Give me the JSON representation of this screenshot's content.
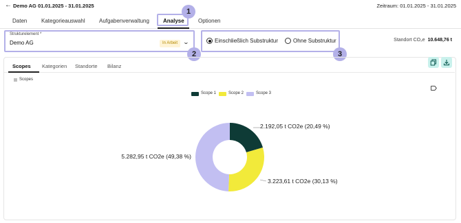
{
  "header": {
    "title": "Demo AG 01.01.2025 - 31.01.2025",
    "period_label": "Zeitraum:",
    "period_value": "01.01.2025 - 31.01.2025"
  },
  "tabs": [
    "Daten",
    "Kategorieauswahl",
    "Aufgabenverwaltung",
    "Analyse",
    "Optionen"
  ],
  "active_tab": "Analyse",
  "callouts": [
    "1",
    "2",
    "3"
  ],
  "structure": {
    "label": "Strukturelement *",
    "value": "Demo AG",
    "status": "In Arbeit"
  },
  "options": {
    "include_label": "Einschließlich Substruktur",
    "exclude_label": "Ohne Substruktur",
    "selected": "include"
  },
  "standort": {
    "label": "Standort CO₂e",
    "value": "10.648,76 t"
  },
  "subtabs": [
    "Scopes",
    "Kategorien",
    "Standorte",
    "Bilanz"
  ],
  "active_subtab": "Scopes",
  "icons": {
    "copy": "copy-icon",
    "download": "download-icon",
    "label": "label-icon",
    "back": "back-arrow-icon",
    "dropdown": "chevron-down-icon"
  },
  "chart_data": {
    "type": "pie",
    "subtype": "donut",
    "title": "Scopes",
    "legend_position": "top",
    "series": [
      {
        "name": "Scope 1",
        "value": 2192.05,
        "label": "2.192,05 t  CO2e (20,49 %)",
        "color": "#0e3b36"
      },
      {
        "name": "Scope 2",
        "value": 3223.61,
        "label": "3.223,61 t  CO2e (30,13 %)",
        "color": "#f2ea3a"
      },
      {
        "name": "Scope 3",
        "value": 5282.95,
        "label": "5.282,95 t  CO2e (49,38 %)",
        "color": "#c2bff2"
      }
    ]
  }
}
